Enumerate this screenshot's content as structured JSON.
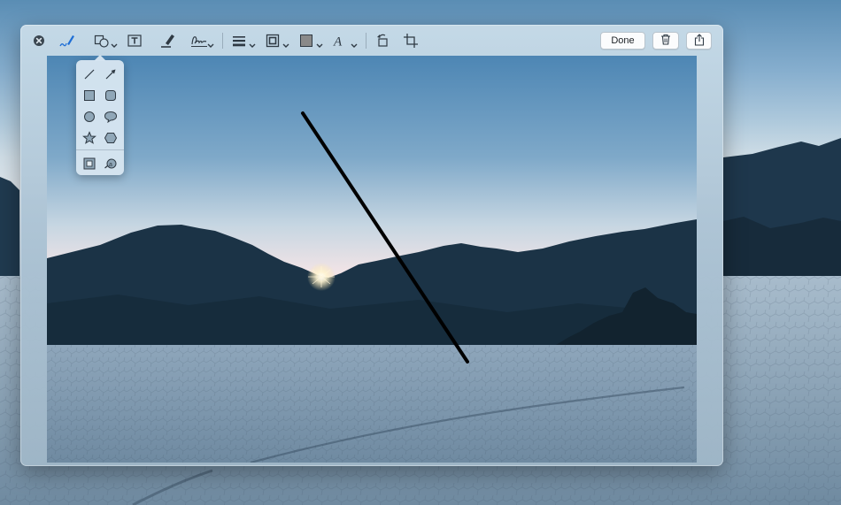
{
  "window": {
    "app": "Markup"
  },
  "toolbar": {
    "close": {
      "icon": "close-circle-icon"
    },
    "left_tools": [
      {
        "name": "sketch-tool",
        "icon": "sketch-pen-icon",
        "selected": true
      },
      {
        "name": "shapes-tool",
        "icon": "shapes-icon",
        "dropdown": true,
        "open": true
      },
      {
        "name": "text-tool",
        "icon": "text-box-icon"
      },
      {
        "name": "highlight-tool",
        "icon": "highlighter-icon"
      },
      {
        "name": "sign-tool",
        "icon": "signature-icon",
        "dropdown": true
      },
      {
        "name": "line-style-tool",
        "icon": "line-weight-icon",
        "dropdown": true
      },
      {
        "name": "border-color-tool",
        "icon": "border-color-icon",
        "dropdown": true
      },
      {
        "name": "fill-color-tool",
        "icon": "fill-color-icon",
        "dropdown": true,
        "color": "#8a8a8a"
      },
      {
        "name": "text-style-tool",
        "icon": "text-style-icon",
        "dropdown": true
      },
      {
        "name": "rotate-tool",
        "icon": "rotate-left-icon"
      },
      {
        "name": "crop-tool",
        "icon": "crop-icon"
      }
    ],
    "done_label": "Done",
    "delete": {
      "icon": "trash-icon"
    },
    "share": {
      "icon": "share-icon"
    }
  },
  "shapes_menu": {
    "items": [
      {
        "name": "line",
        "icon": "line-icon"
      },
      {
        "name": "arrow",
        "icon": "arrow-icon"
      },
      {
        "name": "rectangle",
        "icon": "square-icon"
      },
      {
        "name": "rounded-rectangle",
        "icon": "rounded-square-icon"
      },
      {
        "name": "oval",
        "icon": "circle-icon"
      },
      {
        "name": "speech-bubble",
        "icon": "speech-bubble-icon"
      },
      {
        "name": "star",
        "icon": "star-icon"
      },
      {
        "name": "polygon",
        "icon": "hexagon-icon"
      }
    ],
    "extras": [
      {
        "name": "mask",
        "icon": "mask-icon"
      },
      {
        "name": "loupe",
        "icon": "loupe-icon"
      }
    ]
  },
  "colors": {
    "accent": "#1f6fd6",
    "icon": "#2f3a44",
    "annotation_stroke": "#000000",
    "sky_top": "#4d86b4",
    "sky_horizon": "#f3e4e6",
    "mountains": "#1b3346",
    "playa": "#7a95ac"
  }
}
